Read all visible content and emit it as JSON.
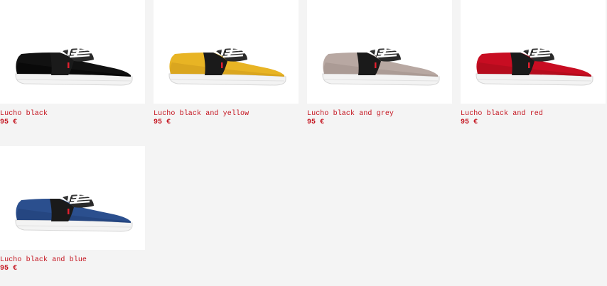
{
  "products": [
    {
      "name": "Lucho black",
      "price": "95 €",
      "color": "#111111",
      "shade": "#000000"
    },
    {
      "name": "Lucho black and yellow",
      "price": "95 €",
      "color": "#e8b424",
      "shade": "#c9951a"
    },
    {
      "name": "Lucho black and grey",
      "price": "95 €",
      "color": "#b8a8a2",
      "shade": "#9c8c86"
    },
    {
      "name": "Lucho black and red",
      "price": "95 €",
      "color": "#c80d22",
      "shade": "#9e0a19"
    },
    {
      "name": "Lucho black and blue",
      "price": "95 €",
      "color": "#2b4f8e",
      "shade": "#1f3b70"
    }
  ],
  "colors": {
    "background": "#f4f4f4",
    "text": "#c4121d",
    "card": "#ffffff"
  }
}
